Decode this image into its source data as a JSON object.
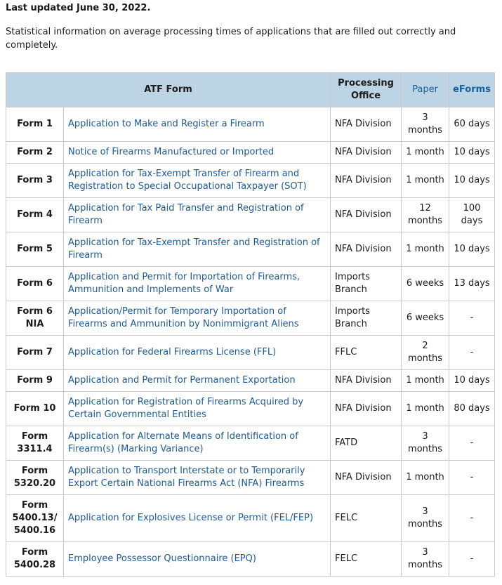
{
  "header": {
    "updated": "Last updated June 30, 2022.",
    "intro": "Statistical information on average processing times of applications that are filled out correctly and completely."
  },
  "table": {
    "columns": {
      "form": "ATF Form",
      "office": "Processing Office",
      "paper": "Paper",
      "eforms": "eForms"
    },
    "rows": [
      {
        "form": "Form 1",
        "title": "Application to Make and Register a Firearm",
        "office": "NFA Division",
        "paper": "3 months",
        "eforms": "60 days"
      },
      {
        "form": "Form 2",
        "title": "Notice of Firearms Manufactured or Imported",
        "office": "NFA Division",
        "paper": "1 month",
        "eforms": "10 days"
      },
      {
        "form": "Form 3",
        "title": "Application for Tax-Exempt Transfer of Firearm and Registration to Special Occupational Taxpayer (SOT)",
        "office": "NFA Division",
        "paper": "1 month",
        "eforms": "10 days"
      },
      {
        "form": "Form 4",
        "title": "Application for Tax Paid Transfer and Registration of Firearm",
        "office": "NFA Division",
        "paper": "12 months",
        "eforms": "100 days"
      },
      {
        "form": "Form 5",
        "title": "Application for Tax-Exempt Transfer and Registration of Firearm",
        "office": "NFA Division",
        "paper": "1 month",
        "eforms": "10 days"
      },
      {
        "form": "Form 6",
        "title": "Application and Permit for Importation of Firearms, Ammunition and Implements of War",
        "office": "Imports Branch",
        "paper": "6 weeks",
        "eforms": "13 days"
      },
      {
        "form": "Form 6 NIA",
        "title": "Application/Permit for Temporary Importation of Firearms and Ammunition by Nonimmigrant Aliens",
        "office": "Imports Branch",
        "paper": "6 weeks",
        "eforms": "-"
      },
      {
        "form": "Form 7",
        "title": "Application for Federal Firearms License (FFL)",
        "office": "FFLC",
        "paper": "2 months",
        "eforms": "-"
      },
      {
        "form": "Form 9",
        "title": "Application and Permit for Permanent Exportation",
        "office": "NFA Division",
        "paper": "1 month",
        "eforms": "10 days"
      },
      {
        "form": "Form 10",
        "title": "Application for Registration of Firearms Acquired by Certain Governmental Entities",
        "office": "NFA Division",
        "paper": "1 month",
        "eforms": "80 days"
      },
      {
        "form": "Form 3311.4",
        "title": "Application for Alternate Means of Identification of Firearm(s) (Marking Variance)",
        "office": "FATD",
        "paper": "3 months",
        "eforms": "-"
      },
      {
        "form": "Form 5320.20",
        "title": "Application to Transport Interstate or to Temporarily Export Certain National Firearms Act (NFA) Firearms",
        "office": "NFA Division",
        "paper": "1 month",
        "eforms": "-"
      },
      {
        "form": "Form 5400.13/ 5400.16",
        "title": "Application for Explosives License or Permit (FEL/FEP)",
        "office": "FELC",
        "paper": "3 months",
        "eforms": "-"
      },
      {
        "form": "Form 5400.28",
        "title": "Employee Possessor Questionnaire (EPQ)",
        "office": "FELC",
        "paper": "3 months",
        "eforms": "-"
      }
    ]
  },
  "colors": {
    "header_bg": "#bdd4e4",
    "link": "#1d5a94",
    "border": "#c8c8c8"
  }
}
